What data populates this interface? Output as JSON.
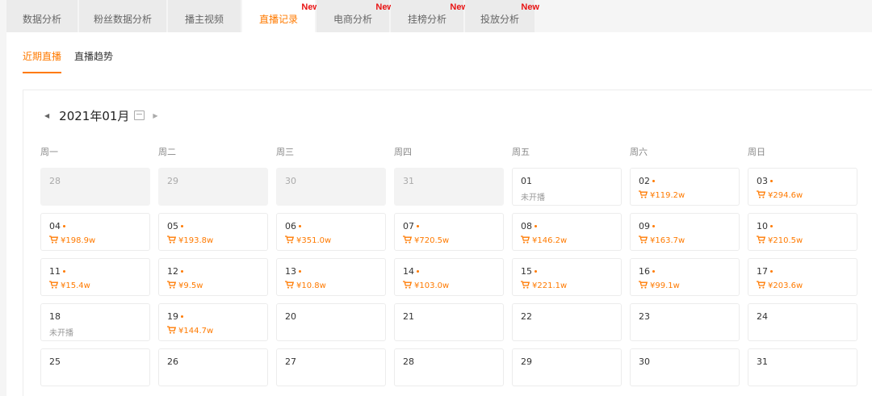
{
  "tabs": [
    {
      "label": "数据分析",
      "new": false,
      "active": false
    },
    {
      "label": "粉丝数据分析",
      "new": false,
      "active": false
    },
    {
      "label": "播主视频",
      "new": false,
      "active": false
    },
    {
      "label": "直播记录",
      "new": true,
      "active": true
    },
    {
      "label": "电商分析",
      "new": true,
      "active": false
    },
    {
      "label": "挂榜分析",
      "new": true,
      "active": false
    },
    {
      "label": "投放分析",
      "new": true,
      "active": false
    }
  ],
  "new_badge": "New",
  "subtabs": [
    {
      "label": "近期直播",
      "active": true
    },
    {
      "label": "直播趋势",
      "active": false
    }
  ],
  "calendar": {
    "month_title": "2021年01月",
    "weekdays": [
      "周一",
      "周二",
      "周三",
      "周四",
      "周五",
      "周六",
      "周日"
    ],
    "days": [
      {
        "num": "28",
        "other": true
      },
      {
        "num": "29",
        "other": true
      },
      {
        "num": "30",
        "other": true
      },
      {
        "num": "31",
        "other": true
      },
      {
        "num": "01",
        "status": "未开播"
      },
      {
        "num": "02",
        "dot": true,
        "sales": "¥119.2w"
      },
      {
        "num": "03",
        "dot": true,
        "sales": "¥294.6w"
      },
      {
        "num": "04",
        "dot": true,
        "sales": "¥198.9w"
      },
      {
        "num": "05",
        "dot": true,
        "sales": "¥193.8w"
      },
      {
        "num": "06",
        "dot": true,
        "sales": "¥351.0w"
      },
      {
        "num": "07",
        "dot": true,
        "sales": "¥720.5w"
      },
      {
        "num": "08",
        "dot": true,
        "sales": "¥146.2w"
      },
      {
        "num": "09",
        "dot": true,
        "sales": "¥163.7w"
      },
      {
        "num": "10",
        "dot": true,
        "sales": "¥210.5w"
      },
      {
        "num": "11",
        "dot": true,
        "sales": "¥15.4w"
      },
      {
        "num": "12",
        "dot": true,
        "sales": "¥9.5w"
      },
      {
        "num": "13",
        "dot": true,
        "sales": "¥10.8w"
      },
      {
        "num": "14",
        "dot": true,
        "sales": "¥103.0w"
      },
      {
        "num": "15",
        "dot": true,
        "sales": "¥221.1w"
      },
      {
        "num": "16",
        "dot": true,
        "sales": "¥99.1w"
      },
      {
        "num": "17",
        "dot": true,
        "sales": "¥203.6w"
      },
      {
        "num": "18",
        "status": "未开播"
      },
      {
        "num": "19",
        "dot": true,
        "sales": "¥144.7w"
      },
      {
        "num": "20"
      },
      {
        "num": "21"
      },
      {
        "num": "22"
      },
      {
        "num": "23"
      },
      {
        "num": "24"
      },
      {
        "num": "25"
      },
      {
        "num": "26"
      },
      {
        "num": "27"
      },
      {
        "num": "28"
      },
      {
        "num": "29"
      },
      {
        "num": "30"
      },
      {
        "num": "31"
      }
    ]
  },
  "colors": {
    "accent": "#ff7a00",
    "new_badge": "#e81313"
  },
  "icons": {
    "prev": "caret-left-icon",
    "next": "caret-right-icon",
    "calendar": "calendar-icon",
    "cart": "cart-icon"
  }
}
